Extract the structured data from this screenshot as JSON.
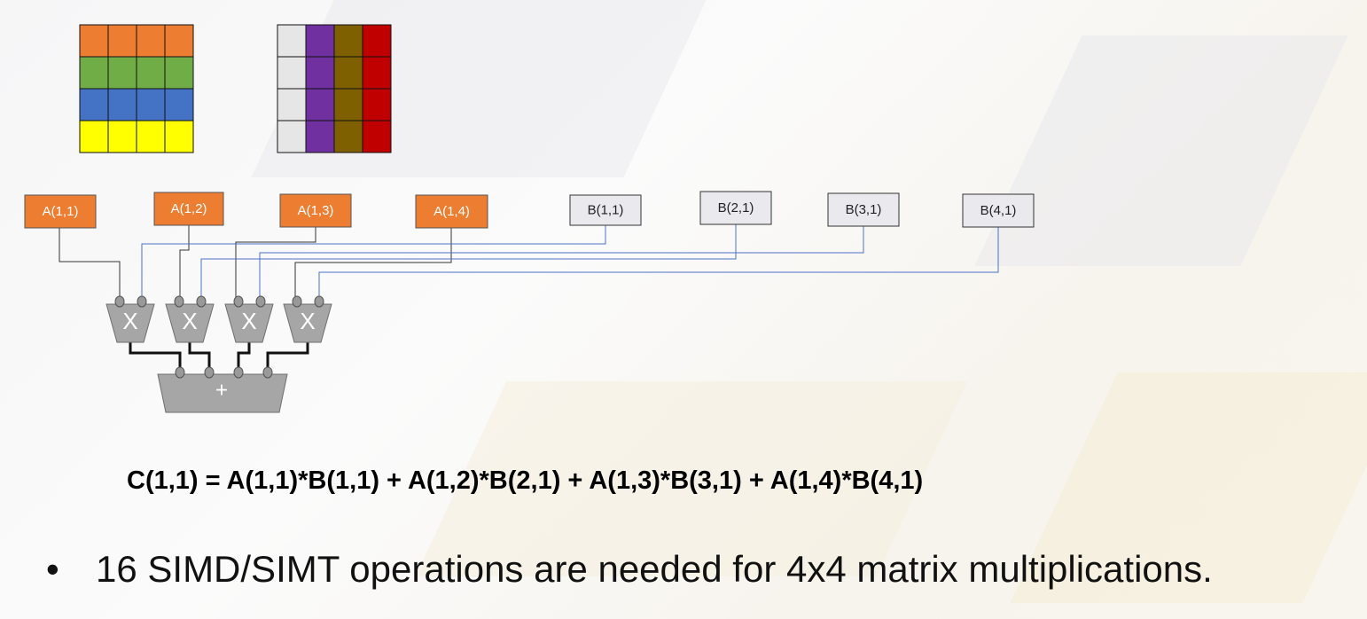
{
  "matrix_a": {
    "row_colors": [
      "#ed7d31",
      "#70ad47",
      "#4472c4",
      "#ffff00"
    ]
  },
  "matrix_b": {
    "col_colors": [
      "#e6e6e6",
      "#7030a0",
      "#7f6000",
      "#c00000"
    ]
  },
  "a_inputs": [
    {
      "label": "A(1,1)"
    },
    {
      "label": "A(1,2)"
    },
    {
      "label": "A(1,3)"
    },
    {
      "label": "A(1,4)"
    }
  ],
  "b_inputs": [
    {
      "label": "B(1,1)"
    },
    {
      "label": "B(2,1)"
    },
    {
      "label": "B(3,1)"
    },
    {
      "label": "B(4,1)"
    }
  ],
  "multipliers": [
    {
      "label": "X"
    },
    {
      "label": "X"
    },
    {
      "label": "X"
    },
    {
      "label": "X"
    }
  ],
  "adder": {
    "label": "+"
  },
  "colors": {
    "a_box": "#ed7d31",
    "b_box": "#e9e9ee",
    "a_wire": "#333333",
    "b_wire": "#4a72c8",
    "unit_fill": "#a6a6a6",
    "unit_stroke": "#6e6e6e"
  },
  "equation": "C(1,1) = A(1,1)*B(1,1) + A(1,2)*B(2,1) + A(1,3)*B(3,1) + A(1,4)*B(4,1)",
  "bullet": "16 SIMD/SIMT operations are needed for 4x4 matrix multiplications."
}
